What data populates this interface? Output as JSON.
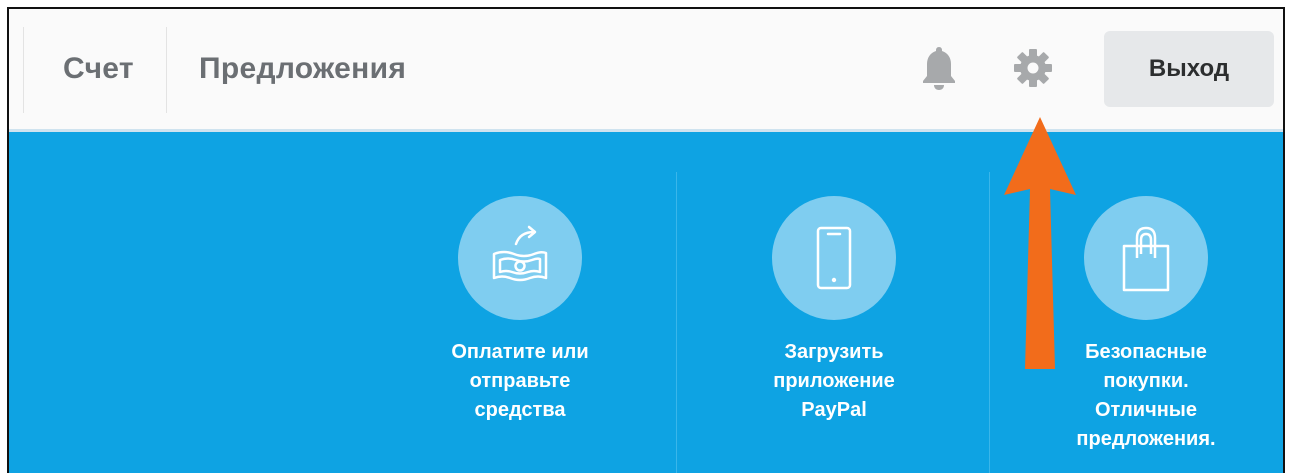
{
  "header": {
    "nav": [
      {
        "label": "Счет"
      },
      {
        "label": "Предложения"
      }
    ],
    "notifications_icon": "bell-icon",
    "settings_icon": "gear-icon",
    "logout_label": "Выход"
  },
  "banner": {
    "features": [
      {
        "icon": "money-transfer-icon",
        "text": "Оплатите или\nотправьте\nсредства"
      },
      {
        "icon": "smartphone-icon",
        "text": "Загрузить\nприложение\nPayPal"
      },
      {
        "icon": "shopping-bag-icon",
        "text": "Безопасные\nпокупки.\nОтличные\nпредложения."
      }
    ]
  },
  "annotation": {
    "arrow_icon": "orange-arrow-icon",
    "arrow_color": "#f26c1b"
  },
  "colors": {
    "banner": "#0ea3e3",
    "circle": "#7fcdf0",
    "topbar": "#fafafa",
    "logout_bg": "#e6e8ea"
  }
}
